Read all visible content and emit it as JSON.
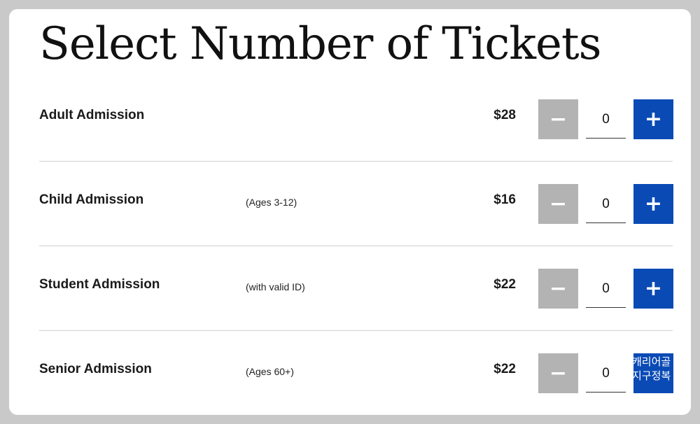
{
  "page": {
    "title": "Select Number of Tickets"
  },
  "tickets": [
    {
      "name": "Adult Admission",
      "note": "",
      "price": "$28",
      "quantity": "0",
      "minus_label": "−",
      "plus_label": "+"
    },
    {
      "name": "Child Admission",
      "note": "(Ages 3-12)",
      "price": "$16",
      "quantity": "0",
      "minus_label": "−",
      "plus_label": "+"
    },
    {
      "name": "Student Admission",
      "note": "(with valid ID)",
      "price": "$22",
      "quantity": "0",
      "minus_label": "−",
      "plus_label": "+"
    },
    {
      "name": "Senior Admission",
      "note": "(Ages 60+)",
      "price": "$22",
      "quantity": "0",
      "minus_label": "−",
      "plus_label": ""
    }
  ],
  "overlay": {
    "lines": [
      "(...)",
      "캐리어골",
      "지구정복"
    ]
  },
  "colors": {
    "accent": "#0a4ab5",
    "disabled": "#b3b3b3",
    "divider": "#d0d0d0",
    "background": "#c9c9c9"
  }
}
